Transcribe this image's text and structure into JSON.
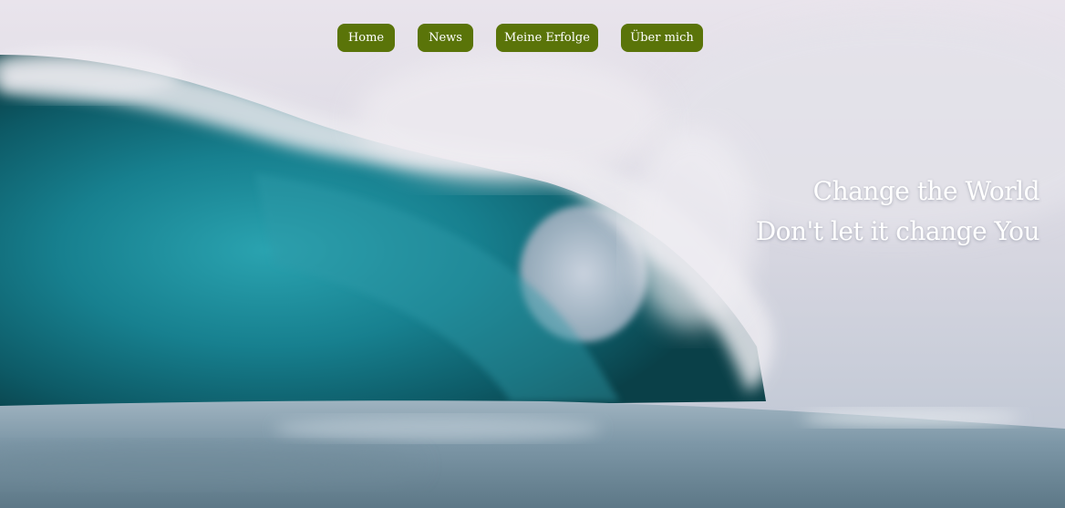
{
  "nav": {
    "items": [
      {
        "label": "Home"
      },
      {
        "label": "News"
      },
      {
        "label": "Meine Erfolge"
      },
      {
        "label": "Über mich"
      }
    ],
    "button_color": "#5a7409"
  },
  "hero": {
    "line1": "Change the World",
    "line2": "Don't let it change You",
    "image": "ocean-wave"
  }
}
